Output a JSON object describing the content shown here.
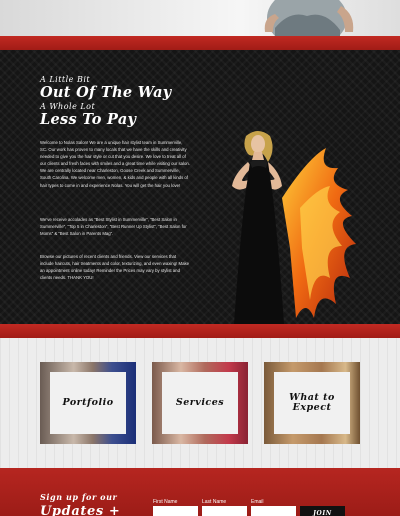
{
  "hero": {
    "image": "woman-portrait-crop"
  },
  "main": {
    "kicker1": "A Little Bit",
    "headline1": "Out Of The Way",
    "kicker2": "A Whole Lot",
    "headline2": "Less To Pay",
    "paragraph1": "Welcome to Nolas Salon! We are a unique hair stylist team in Summerville, SC. Our work has proven to many locals that we have the skills and creativity needed to give you the hair style or cut that you desire. We love to treat all of our clients and fresh faces with smiles and a great time while visiting our salon. We are centrally located near Charleston, Goose Creek and Summerville, South Carolina. We welcome men, women, & kids and people with all kinds of hair types to come in and experience Nolas. You will get the hair you love!",
    "paragraph2": "We've receive accolades as “Best Stylist in Summerville”, “Best Salon in Summerville”, “Top 5 in Charleston”, “Best Runner Up Stylist”, “Best Salon for Moms” & “Best Salon in Parents Mag”.",
    "paragraph3": "Browse our pictures of recent clients and friends. View our services that include haircuts, hair treatments and color, texturizing, and even waxing! Make an appointment online today! Reminder the Prices may vary by stylist and clients needs. THANK YOU!"
  },
  "cards": [
    {
      "label": "Portfolio"
    },
    {
      "label": "Services"
    },
    {
      "label": "What to Expect"
    }
  ],
  "signup": {
    "title_line1": "Sign up for our",
    "title_line2": "Updates +",
    "first_name_label": "First Name",
    "last_name_label": "Last Name",
    "email_label": "Email",
    "join_label": "JOIN"
  },
  "colors": {
    "brand_red": "#b52620",
    "dark_bg": "#151515",
    "light_bg": "#ededed"
  }
}
